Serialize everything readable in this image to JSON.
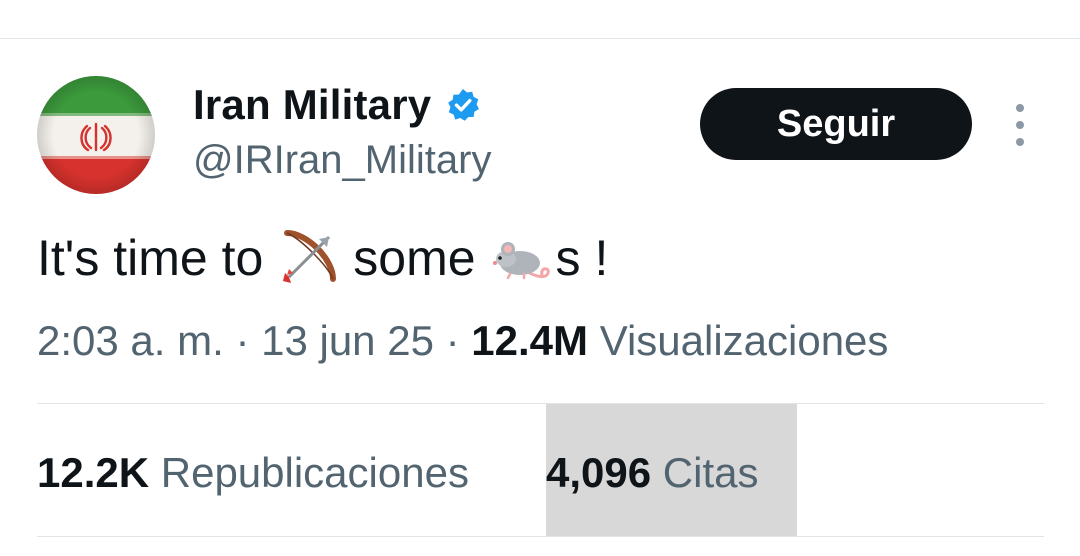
{
  "user": {
    "display_name": "Iran Military",
    "handle": "@IRIran_Military",
    "verified": true,
    "avatar": "iran-flag-icon"
  },
  "follow_button": {
    "label": "Seguir"
  },
  "more_menu": {
    "icon": "more-vertical-icon"
  },
  "tweet": {
    "text_part1": "It's time to",
    "emoji1": "bow-and-arrow-icon",
    "text_part2": "some",
    "emoji2": "mouse-icon",
    "text_part3": "s !"
  },
  "meta": {
    "time": "2:03 a. m.",
    "separator": "·",
    "date": "13 jun 25",
    "views_count": "12.4M",
    "views_label": "Visualizaciones"
  },
  "stats": {
    "reposts_count": "12.2K",
    "reposts_label": "Republicaciones",
    "quotes_count": "4,096",
    "quotes_label": "Citas"
  },
  "colors": {
    "text": "#0f1419",
    "secondary_text": "#536471",
    "verified_badge": "#1d9bf0",
    "button_bg": "#0f1419",
    "divider": "#e1e5e8",
    "highlight": "#d8d8d8"
  }
}
